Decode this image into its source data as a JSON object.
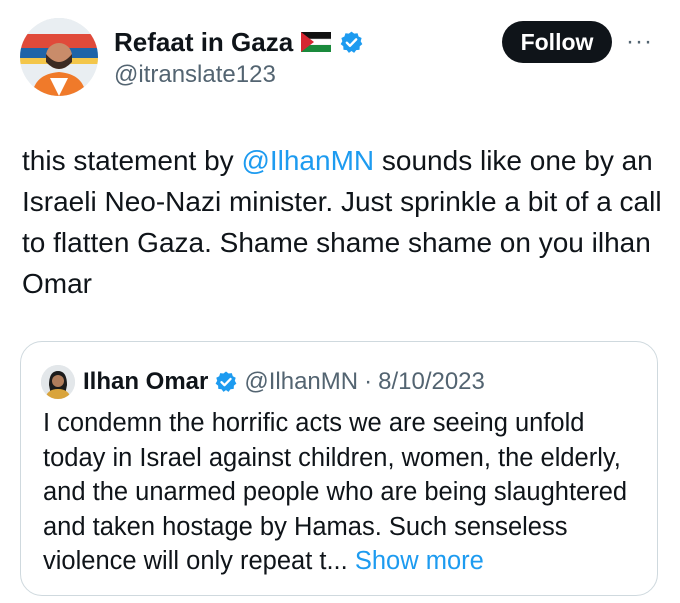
{
  "author": {
    "display_name": "Refaat in Gaza",
    "flag_icon": "palestine-flag-icon",
    "verified_icon": "verified-badge-icon",
    "handle": "@itranslate123"
  },
  "actions": {
    "follow_label": "Follow",
    "more_label": "···"
  },
  "tweet": {
    "text_before": "this statement by ",
    "mention": "@IlhanMN",
    "text_after": " sounds like one by an Israeli Neo-Nazi minister. Just sprinkle a bit of a call to flatten Gaza. Shame shame shame on you ilhan Omar"
  },
  "quoted": {
    "display_name": "Ilhan Omar",
    "handle": "@IlhanMN",
    "separator": "·",
    "date": "8/10/2023",
    "text": "I condemn the horrific acts we are seeing unfold today in Israel against children, women, the elderly, and the unarmed people who are being slaughtered and taken hostage by Hamas. Such senseless violence will only repeat t...",
    "show_more_label": "Show more"
  },
  "colors": {
    "link": "#1d9bf0",
    "verified": "#1d9bf0",
    "text": "#0f1419",
    "secondary": "#536471",
    "border": "#cfd9de"
  }
}
